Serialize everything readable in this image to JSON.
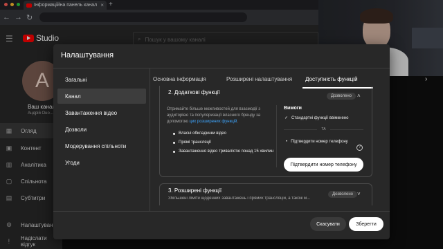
{
  "browser": {
    "tab_title": "Інформаційна панель канал",
    "tab_close": "×",
    "new_tab": "+"
  },
  "studio": {
    "logo_text": "Studio",
    "search_placeholder": "Пошук у вашому каналі"
  },
  "channel": {
    "avatar_letter": "A",
    "name": "Ваш канал",
    "subtitle": "Андрій Оно..."
  },
  "leftnav": {
    "items": [
      {
        "label": "Огляд",
        "icon": "grid-icon"
      },
      {
        "label": "Контент",
        "icon": "play-box-icon"
      },
      {
        "label": "Аналітика",
        "icon": "bar-chart-icon"
      },
      {
        "label": "Спільнота",
        "icon": "comment-icon"
      },
      {
        "label": "Субтитри",
        "icon": "subtitles-icon"
      }
    ],
    "bottom": [
      {
        "label": "Налаштування",
        "icon": "gear-icon"
      },
      {
        "label": "Надіслати відгук",
        "icon": "feedback-icon"
      }
    ]
  },
  "modal": {
    "title": "Налаштування",
    "side_items": [
      "Загальні",
      "Канал",
      "Завантаження відео",
      "Дозволи",
      "Модерування спільноти",
      "Угоди"
    ],
    "active_side": 1,
    "tabs": [
      "Основна інформація",
      "Розширені налаштування",
      "Доступність функцій"
    ],
    "active_tab": 2,
    "section2": {
      "title": "2. Додаткові функції",
      "badge": "Дозволено",
      "desc_before": "Отримайте більше можливостей для взаємодії з аудиторією та популяризації власного бренду за допомогою ",
      "desc_link": "цих розширених функцій",
      "desc_after": ".",
      "bullets": [
        "Власні обкладинки відео",
        "Прямі трансляції",
        "Завантаження відео тривалістю понад 15 хвилин"
      ]
    },
    "requirements": {
      "title": "Вимоги",
      "item1": "Стандартні функції ввімкнено",
      "or": "ТА",
      "item2": "Підтвердити номер телефону",
      "help": "?",
      "verify_button": "Підтвердити номер телефону"
    },
    "section3": {
      "title": "3. Розширені функції",
      "desc": "Збільшені ліміти щоденних завантажень і прямих трансляцій, а також м...",
      "badge": "Дозволено"
    },
    "cancel": "Скасувати",
    "save": "Зберегти"
  },
  "colors": {
    "accent_link": "#3ea6ff",
    "brand_red": "#ff0000",
    "dialog_bg": "#282828"
  }
}
